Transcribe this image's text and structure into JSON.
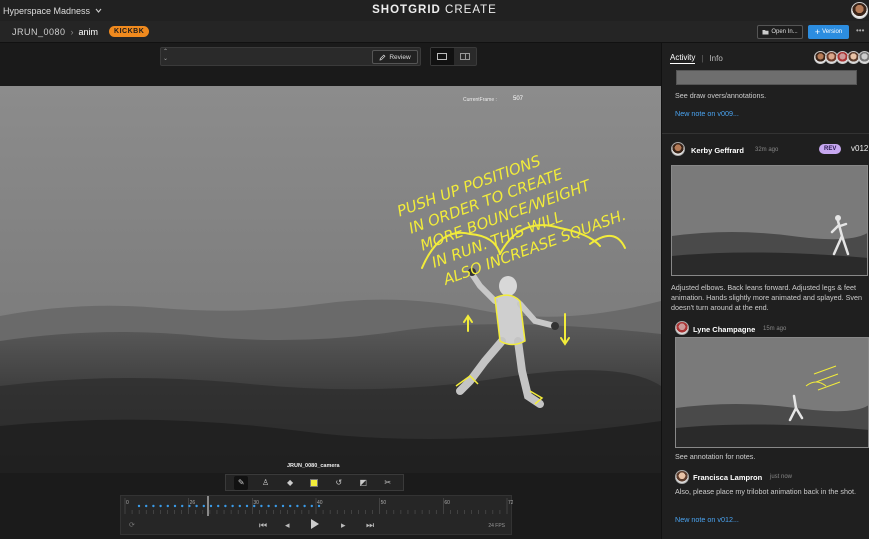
{
  "app": {
    "project_name": "Hyperspace Madness",
    "brand_bold": "SHOTGRID",
    "brand_light": "CREATE"
  },
  "shot": {
    "code": "JRUN_0080",
    "task": "anim",
    "status": "KICKBK"
  },
  "header_actions": {
    "open_in": "Open In...",
    "version": "Version"
  },
  "viewer": {
    "review_label": "Review",
    "current_frame_label": "CurrentFrame :",
    "current_frame": "507",
    "camera_label": "JRUN_0080_camera",
    "annotation_lines": [
      "PUSH UP POSITIONS",
      "IN ORDER TO CREATE",
      "MORE BOUNCE/WEIGHT",
      "IN RUN. THIS WILL",
      "ALSO INCREASE SQUASH."
    ]
  },
  "timeline": {
    "ticks": [
      "0",
      "26",
      "30",
      "40",
      "50",
      "60",
      "72"
    ],
    "fps": "24 FPS"
  },
  "panel": {
    "tabs": [
      "Activity",
      "Info"
    ],
    "entries": [
      {
        "text": "See draw overs/annotations.",
        "link": "New note on v009..."
      },
      {
        "author": "Kerby Geffrard",
        "time": "32m ago",
        "tag": "REV",
        "version": "v012",
        "text": "Adjusted elbows. Back leans forward. Adjusted legs & feet animation. Hands slightly more animated and splayed. Sven doesn't turn around at the end."
      },
      {
        "author": "Lyne Champagne",
        "time": "15m ago",
        "text": "See annotation for notes."
      },
      {
        "author": "Francisca Lampron",
        "time": "just now",
        "text": "Also, please place my trilobot animation back in the shot.",
        "link": "New note on v012..."
      }
    ]
  },
  "colors": {
    "accent_blue": "#2c8de0",
    "kick_orange": "#f08a1e",
    "annotation_yellow": "#f2ec3a",
    "rev_purple": "#c7a8f0"
  }
}
